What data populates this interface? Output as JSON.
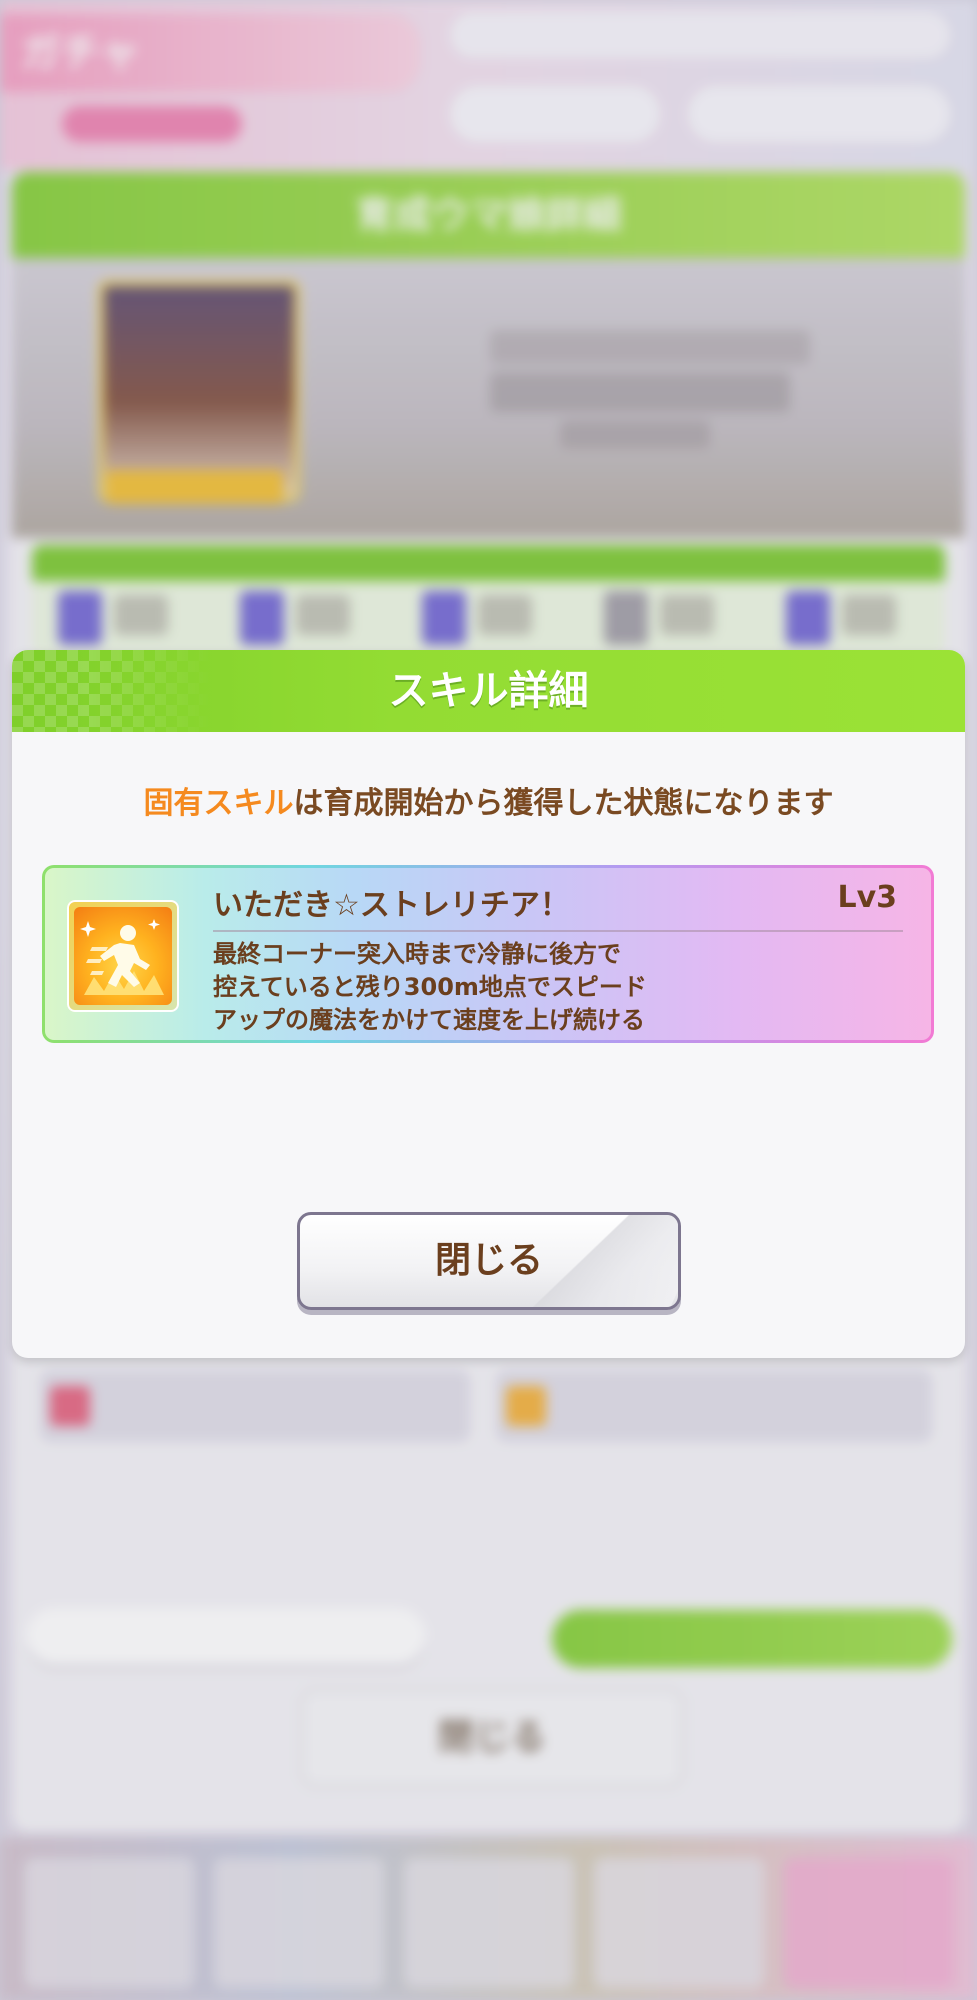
{
  "dialog": {
    "title": "スキル詳細",
    "notice_highlight": "固有スキル",
    "notice_rest": "は育成開始から獲得した状態になります",
    "close_label": "閉じる"
  },
  "skill": {
    "name": "いただき☆ストレリチア！",
    "level": "Lv3",
    "description_lines": [
      "最終コーナー突入時まで冷静に後方で",
      "控えていると残り300m地点でスピード",
      "アップの魔法をかけて速度を上げ続ける"
    ],
    "icon": "speed-skill-running-figure-icon"
  },
  "background": {
    "screen_title": "ガチャ",
    "panel_title": "育成ウマ娘詳細",
    "close_label": "閉じる"
  },
  "colors": {
    "header_green": "#8fd63a",
    "text_brown": "#6b3f1e",
    "highlight_orange": "#f58a1f"
  }
}
